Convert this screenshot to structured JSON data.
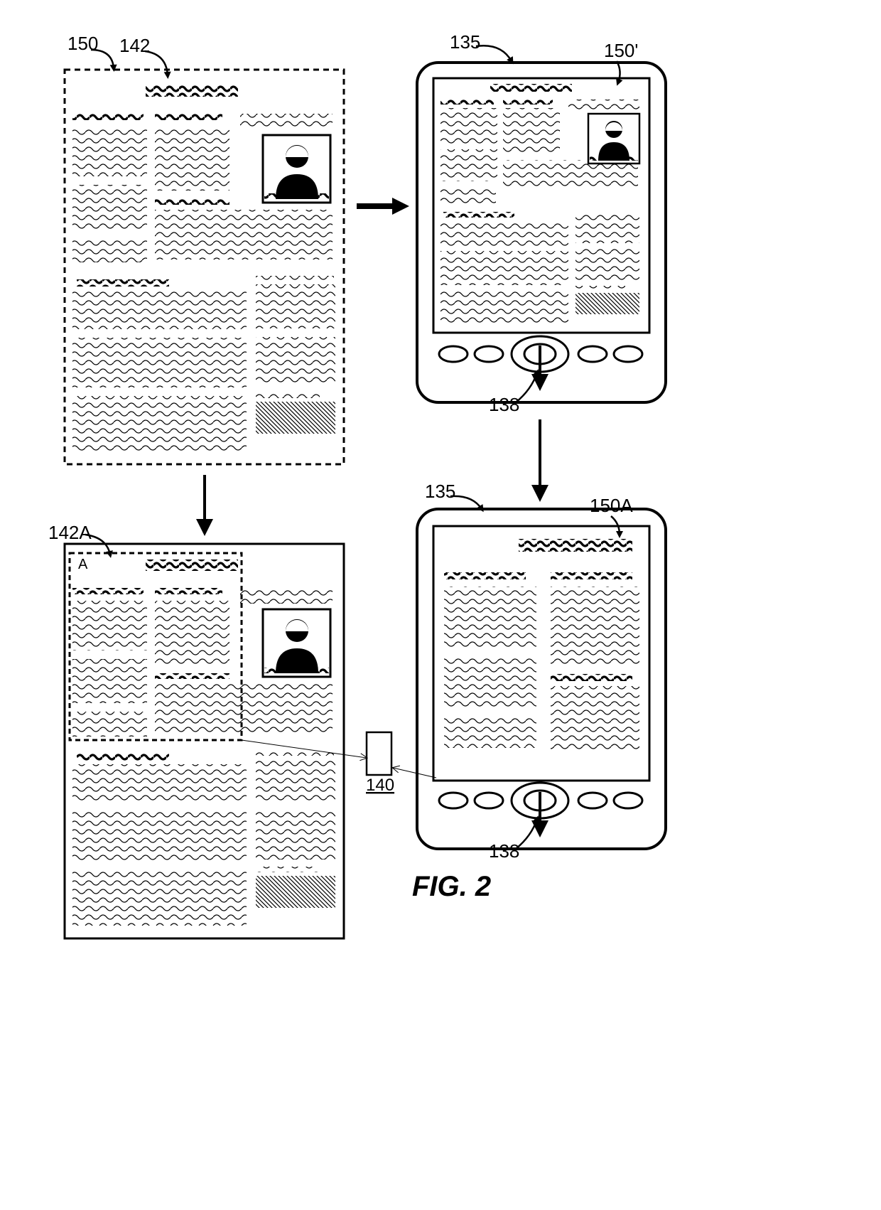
{
  "figure_title": "FIG. 2",
  "labels": {
    "ref150": "150",
    "ref142": "142",
    "ref135_top": "135",
    "ref150prime": "150'",
    "ref138_top": "138",
    "ref142A": "142A",
    "letter_A": "A",
    "ref135_bottom": "135",
    "ref150A": "150A",
    "ref140": "140",
    "ref138_bottom": "138"
  }
}
